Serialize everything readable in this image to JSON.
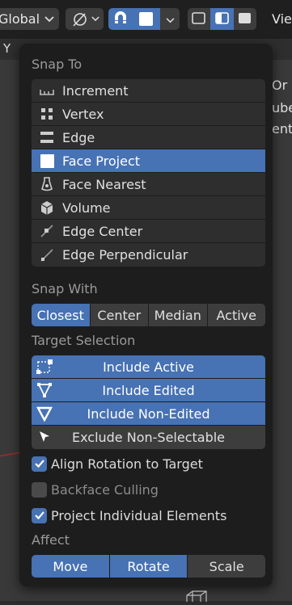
{
  "header": {
    "orientation_label": "Global",
    "view_label": "Vie"
  },
  "sub_bar": {
    "y_label": "Y"
  },
  "right_fragments": [
    "Or",
    "ube",
    "ent"
  ],
  "snap_to": {
    "title": "Snap To",
    "items": [
      {
        "label": "Increment",
        "icon": "increment-icon",
        "selected": false
      },
      {
        "label": "Vertex",
        "icon": "vertex-icon",
        "selected": false
      },
      {
        "label": "Edge",
        "icon": "edge-icon",
        "selected": false
      },
      {
        "label": "Face Project",
        "icon": "face-project-icon",
        "selected": true
      },
      {
        "label": "Face Nearest",
        "icon": "face-nearest-icon",
        "selected": false
      },
      {
        "label": "Volume",
        "icon": "volume-icon",
        "selected": false
      },
      {
        "label": "Edge Center",
        "icon": "edge-center-icon",
        "selected": false
      },
      {
        "label": "Edge Perpendicular",
        "icon": "edge-perpendicular-icon",
        "selected": false
      }
    ]
  },
  "snap_with": {
    "title": "Snap With",
    "options": [
      {
        "label": "Closest",
        "active": true
      },
      {
        "label": "Center",
        "active": false
      },
      {
        "label": "Median",
        "active": false
      },
      {
        "label": "Active",
        "active": false
      }
    ]
  },
  "target_selection": {
    "title": "Target Selection",
    "items": [
      {
        "label": "Include Active",
        "icon": "include-active-icon",
        "on": true
      },
      {
        "label": "Include Edited",
        "icon": "include-edited-icon",
        "on": true
      },
      {
        "label": "Include Non-Edited",
        "icon": "include-non-edited-icon",
        "on": true
      },
      {
        "label": "Exclude Non-Selectable",
        "icon": "cursor-arrow-icon",
        "on": false
      }
    ]
  },
  "options": [
    {
      "label": "Align Rotation to Target",
      "checked": true
    },
    {
      "label": "Backface Culling",
      "checked": false
    },
    {
      "label": "Project Individual Elements",
      "checked": true
    }
  ],
  "affect": {
    "title": "Affect",
    "options": [
      {
        "label": "Move",
        "active": true
      },
      {
        "label": "Rotate",
        "active": true
      },
      {
        "label": "Scale",
        "active": false
      }
    ]
  },
  "colors": {
    "accent": "#4772b3",
    "panel_bg": "#1d1d1d",
    "item_bg": "#2e2e2e"
  }
}
